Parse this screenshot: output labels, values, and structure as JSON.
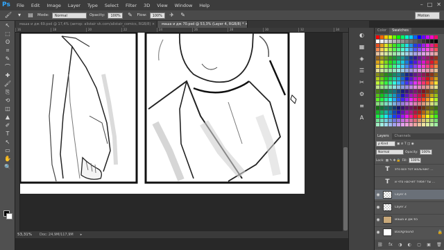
{
  "app": {
    "logo": "Ps"
  },
  "menu": [
    "File",
    "Edit",
    "Image",
    "Layer",
    "Type",
    "Select",
    "Filter",
    "3D",
    "View",
    "Window",
    "Help"
  ],
  "window_controls": [
    "–",
    "□",
    "✕"
  ],
  "options_bar": {
    "mode_label": "Mode:",
    "mode_value": "Normal",
    "opacity_label": "Opacity:",
    "opacity_value": "100%",
    "flow_label": "Flow:",
    "flow_value": "100%"
  },
  "workspace": "Motion",
  "tabs": [
    {
      "label": "маша и дж 69.psd @ 17,4% (автор: alistair vk.com/alistair_comics, RGB/8) ×",
      "active": false
    },
    {
      "label": "маша и дж 70.psd @ 53,3% (Layer 4, RGB/8) *  ×",
      "active": true
    }
  ],
  "ruler_ticks": [
    "16",
    "18",
    "20",
    "22",
    "24",
    "26",
    "28",
    "30",
    "32",
    "34"
  ],
  "status": {
    "zoom": "53,31%",
    "doc": "Doc: 24,9M/117,9M"
  },
  "panels": {
    "color_tabs": [
      "Color",
      "Swatches"
    ],
    "layer_tabs": [
      "Layers",
      "Channels"
    ],
    "kind_filter": "ρ Kind",
    "blend_mode": "Normal",
    "opacity_label": "Opacity:",
    "opacity_value": "100%",
    "lock_label": "Lock:",
    "fill_label": "Fill:",
    "fill_value": "100%"
  },
  "layers": [
    {
      "name": "это всё тот мальчик! ...",
      "type": "text",
      "selected": false
    },
    {
      "name": "и что насчет тебя? ты ...",
      "type": "text",
      "selected": false
    },
    {
      "name": "Layer 4",
      "type": "pixel",
      "selected": true
    },
    {
      "name": "Layer 2",
      "type": "pixel",
      "selected": false
    },
    {
      "name": "маша и дж 65",
      "type": "image",
      "selected": false
    },
    {
      "name": "Background",
      "type": "background",
      "selected": false
    }
  ],
  "tools": [
    "↖",
    "⬚",
    "ʘ",
    "⌗",
    "✎",
    "⌒",
    "✚",
    "🖌",
    "⎘",
    "⟲",
    "◫",
    "▲",
    "✐",
    "T",
    "↖",
    "▭",
    "✋",
    "🔍"
  ],
  "side_buttons": [
    "◐",
    "▦",
    "◈",
    "☰",
    "✂",
    "⚙",
    "≡",
    "A"
  ],
  "footer_icons": [
    "⛓",
    "fx",
    "◑",
    "◐",
    "▢",
    "▣",
    "🗑"
  ]
}
